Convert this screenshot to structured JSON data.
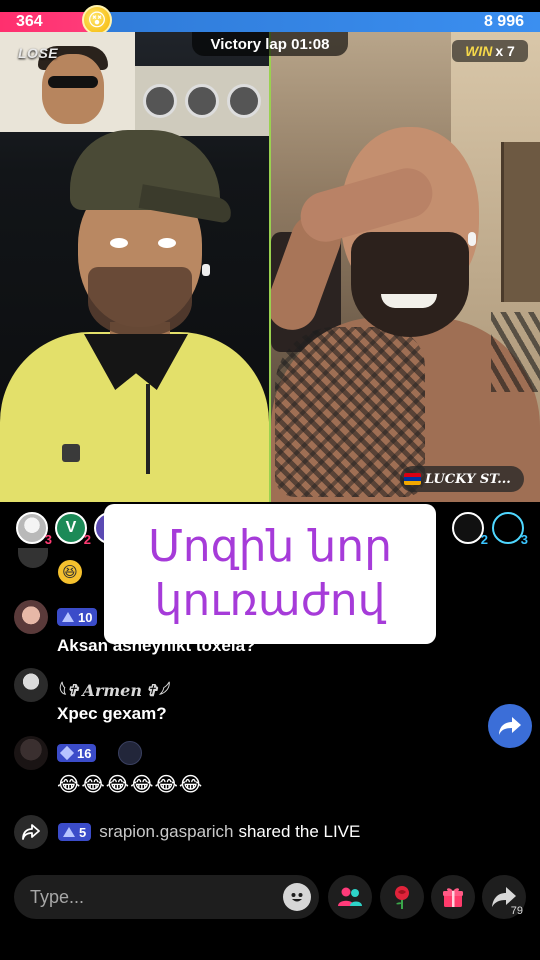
{
  "battle": {
    "left_score": "364",
    "right_score": "8 996",
    "left_result": "LOSE",
    "timer_text": "Victory lap 01:08",
    "win_label": "WIN",
    "win_count": "x 7",
    "left_color": "#ff2f6e",
    "right_color": "#3b8ff0"
  },
  "right_host": {
    "tag": "LUCKY ST..."
  },
  "viewers": [
    {
      "initial": "",
      "count": "3"
    },
    {
      "initial": "V",
      "count": "2"
    },
    {
      "initial": "",
      "count": ""
    },
    {
      "initial": "",
      "count": ""
    },
    {
      "initial": "",
      "count": "2"
    },
    {
      "initial": "",
      "count": "3"
    }
  ],
  "caption": {
    "line1": "Մոզին նոր",
    "line2": "կուռաժով",
    "color": "#a63bd9"
  },
  "chat": [
    {
      "badge": "10",
      "message": "Aksan asheynikt toxela?"
    },
    {
      "username": "𓀀 ✞ Armen ✞ 𓀀",
      "message": "Xpec gexam?"
    },
    {
      "badge": "16",
      "message": "😂😂😂😂😂😂"
    }
  ],
  "share": {
    "badge": "5",
    "username": "srapion.gasparich",
    "text": "shared the LIVE"
  },
  "bottom_bar": {
    "placeholder": "Type...",
    "forward_count": "79"
  }
}
